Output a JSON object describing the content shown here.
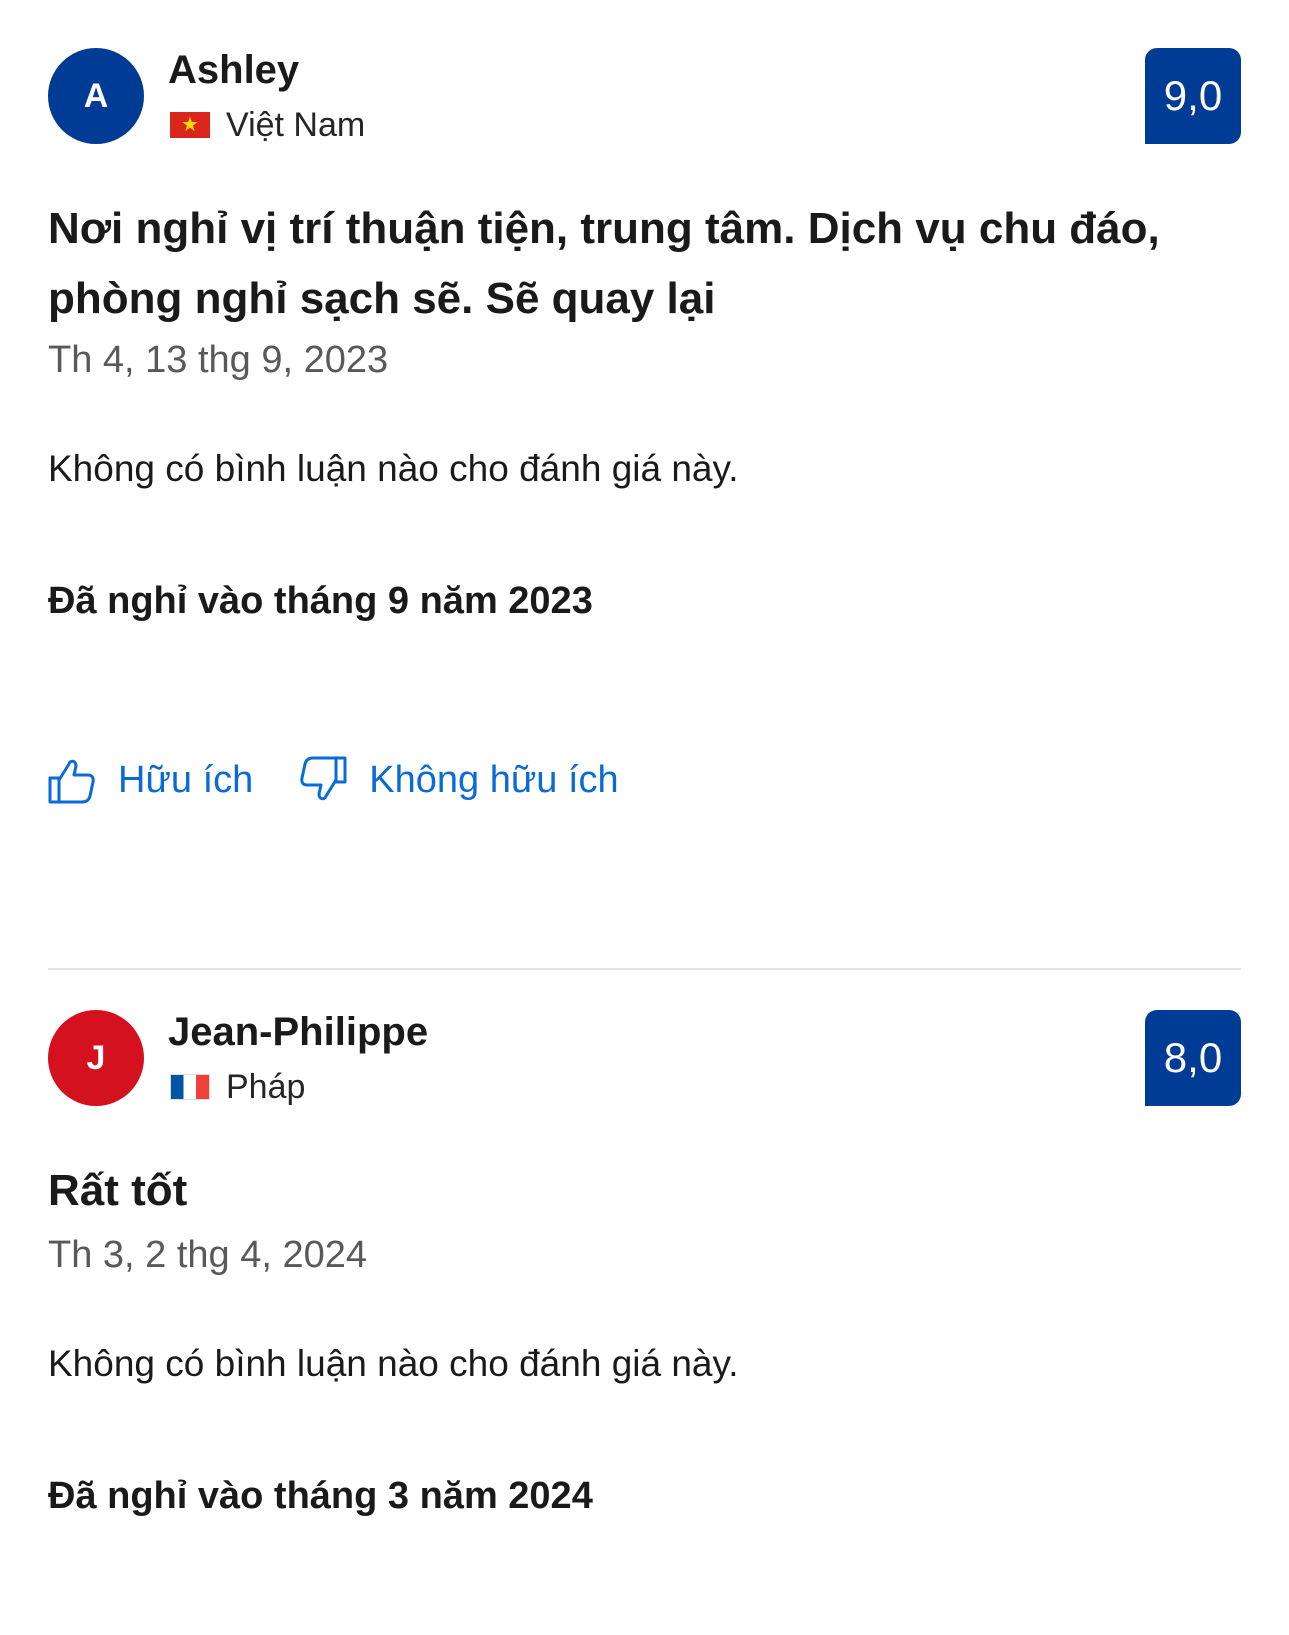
{
  "reviews": [
    {
      "avatar_initial": "A",
      "avatar_color": "#003b95",
      "name": "Ashley",
      "country": "Việt Nam",
      "flag_icon": "vietnam-flag-icon",
      "score": "9,0",
      "title": "Nơi nghỉ vị trí thuận tiện, trung tâm. Dịch vụ chu đáo, phòng nghỉ sạch sẽ. Sẽ quay lại",
      "date": "Th 4, 13 thg 9, 2023",
      "comment": "Không có bình luận nào cho đánh giá này.",
      "stayed": "Đã nghỉ vào tháng 9 năm 2023",
      "helpful_label": "Hữu ích",
      "not_helpful_label": "Không hữu ích"
    },
    {
      "avatar_initial": "J",
      "avatar_color": "#d4111e",
      "name": "Jean-Philippe",
      "country": "Pháp",
      "flag_icon": "france-flag-icon",
      "score": "8,0",
      "title": "Rất tốt",
      "date": "Th 3, 2 thg 4, 2024",
      "comment": "Không có bình luận nào cho đánh giá này.",
      "stayed": "Đã nghỉ vào tháng 3 năm 2024"
    }
  ],
  "colors": {
    "score_background": "#003b95",
    "link": "#0a6bd6"
  }
}
